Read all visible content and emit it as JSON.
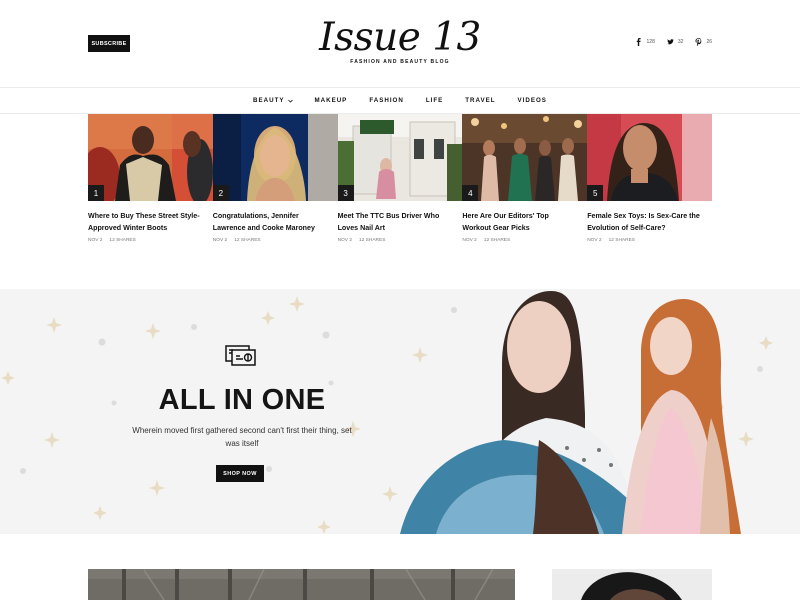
{
  "header": {
    "subscribe_label": "SUBSCRIBE",
    "logo_title": "Issue 13",
    "logo_tagline": "FASHION AND BEAUTY BLOG",
    "social": [
      {
        "icon": "facebook-icon",
        "count": "128"
      },
      {
        "icon": "twitter-icon",
        "count": "32"
      },
      {
        "icon": "pinterest-icon",
        "count": "26"
      }
    ]
  },
  "nav": [
    {
      "label": "BEAUTY",
      "has_dropdown": true
    },
    {
      "label": "MAKEUP",
      "has_dropdown": false
    },
    {
      "label": "FASHION",
      "has_dropdown": false
    },
    {
      "label": "LIFE",
      "has_dropdown": false
    },
    {
      "label": "TRAVEL",
      "has_dropdown": false
    },
    {
      "label": "VIDEOS",
      "has_dropdown": false
    }
  ],
  "posts": [
    {
      "rank": "1",
      "title": "Where to Buy These Street Style-Approved Winter Boots",
      "date": "NOV 2",
      "shares": "12 SHARES"
    },
    {
      "rank": "2",
      "title": "Congratulations, Jennifer Lawrence and Cooke Maroney",
      "date": "NOV 2",
      "shares": "12 SHARES"
    },
    {
      "rank": "3",
      "title": "Meet The TTC Bus Driver Who Loves Nail Art",
      "date": "NOV 2",
      "shares": "12 SHARES"
    },
    {
      "rank": "4",
      "title": "Here Are Our Editors' Top Workout Gear Picks",
      "date": "NOV 2",
      "shares": "12 SHARES"
    },
    {
      "rank": "5",
      "title": "Female Sex Toys: Is Sex-Care the Evolution of Self-Care?",
      "date": "NOV 2",
      "shares": "12 SHARES"
    }
  ],
  "promo": {
    "icon": "gift-card-icon",
    "title": "ALL IN ONE",
    "description": "Wherein moved first gathered second can't first their thing, set was itself",
    "button_label": "SHOP NOW"
  },
  "colors": {
    "dark": "#111111",
    "promo_background": "#f4f4f4",
    "sparkle": "#e9dcc4"
  }
}
